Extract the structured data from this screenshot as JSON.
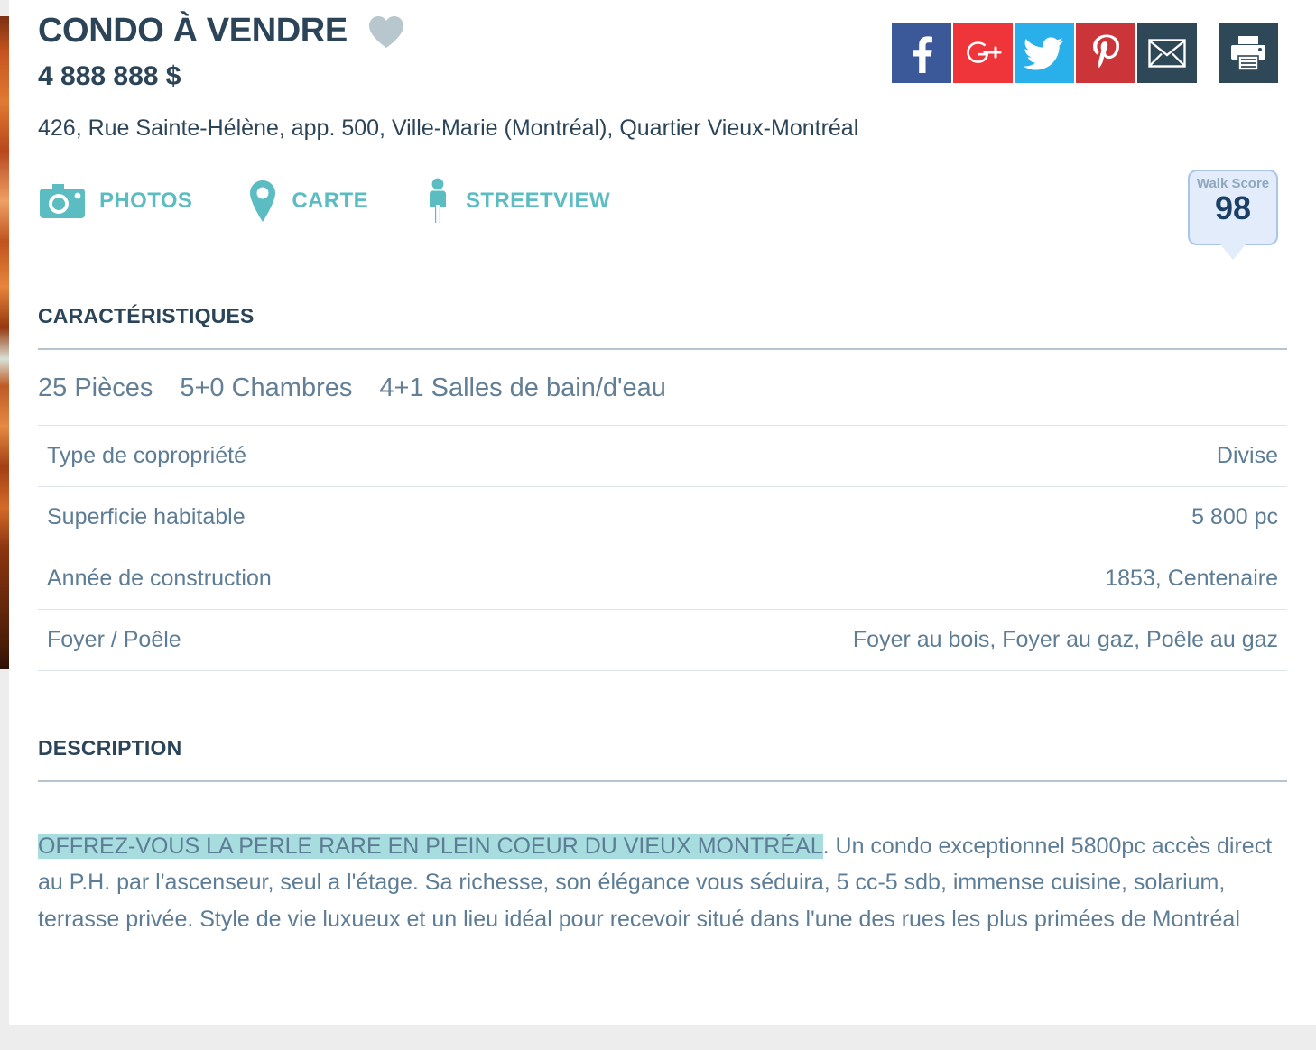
{
  "header": {
    "title": "CONDO À VENDRE",
    "favorite_icon": "heart-icon",
    "price": "4 888 888 $",
    "address": "426, Rue Sainte-Hélène, app. 500, Ville-Marie (Montréal), Quartier Vieux-Montréal"
  },
  "share": {
    "buttons": [
      {
        "name": "facebook",
        "glyph": "f",
        "color": "#3b5998"
      },
      {
        "name": "google-plus",
        "glyph": "g+",
        "color": "#f0353a"
      },
      {
        "name": "twitter",
        "glyph": "bird",
        "color": "#29b0ea"
      },
      {
        "name": "pinterest",
        "glyph": "P",
        "color": "#cb3539"
      },
      {
        "name": "email",
        "glyph": "envelope",
        "color": "#2f4858"
      },
      {
        "name": "print",
        "glyph": "printer",
        "color": "#2f4858"
      }
    ]
  },
  "actions": [
    {
      "label": "PHOTOS",
      "icon": "camera-icon"
    },
    {
      "label": "CARTE",
      "icon": "map-pin-icon"
    },
    {
      "label": "STREETVIEW",
      "icon": "pegman-icon"
    }
  ],
  "walk_score": {
    "label": "Walk Score",
    "value": "98"
  },
  "characteristics": {
    "heading": "CARACTÉRISTIQUES",
    "summary": [
      "25 Pièces",
      "5+0 Chambres",
      "4+1 Salles de bain/d'eau"
    ],
    "rows": [
      {
        "label": "Type de copropriété",
        "value": "Divise"
      },
      {
        "label": "Superficie habitable",
        "value": "5 800 pc"
      },
      {
        "label": "Année de construction",
        "value": "1853, Centenaire"
      },
      {
        "label": "Foyer / Poêle",
        "value": "Foyer au bois, Foyer au gaz, Poêle au gaz"
      }
    ]
  },
  "description": {
    "heading": "DESCRIPTION",
    "highlight": "OFFREZ-VOUS LA PERLE RARE EN PLEIN COEUR DU VIEUX MONTRÉAL",
    "body": ". Un condo exceptionnel 5800pc accès direct au P.H. par l'ascenseur, seul a l'étage. Sa richesse, son élégance vous séduira, 5 cc-5 sdb, immense cuisine, solarium, terrasse privée. Style de vie luxueux et un lieu idéal pour recevoir situé dans l'une des rues les plus primées de Montréal"
  },
  "colors": {
    "navy": "#2b4458",
    "slate": "#5d7c95",
    "teal": "#5bbcc2",
    "highlight": "#a8dde0",
    "rule": "#b5c4cf",
    "heart": "#b8c6ce"
  }
}
